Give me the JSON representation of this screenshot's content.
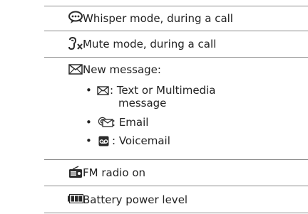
{
  "rows": [
    {
      "icon": "whisper-mode-icon",
      "text": "Whisper mode, during a call"
    },
    {
      "icon": "mute-mode-icon",
      "text": "Mute mode, during a call"
    },
    {
      "icon": "new-message-envelope-icon",
      "text": "New message:",
      "subitems": [
        {
          "icon": "text-message-envelope-icon",
          "label_line1": ": Text or Multimedia",
          "label_line2": "message"
        },
        {
          "icon": "email-at-icon",
          "label_line1": ": Email"
        },
        {
          "icon": "voicemail-icon",
          "label_line1": ": Voicemail"
        }
      ]
    },
    {
      "icon": "fm-radio-icon",
      "text": "FM radio on"
    },
    {
      "icon": "battery-icon",
      "text": "Battery power level"
    }
  ],
  "bullet_char": "•"
}
